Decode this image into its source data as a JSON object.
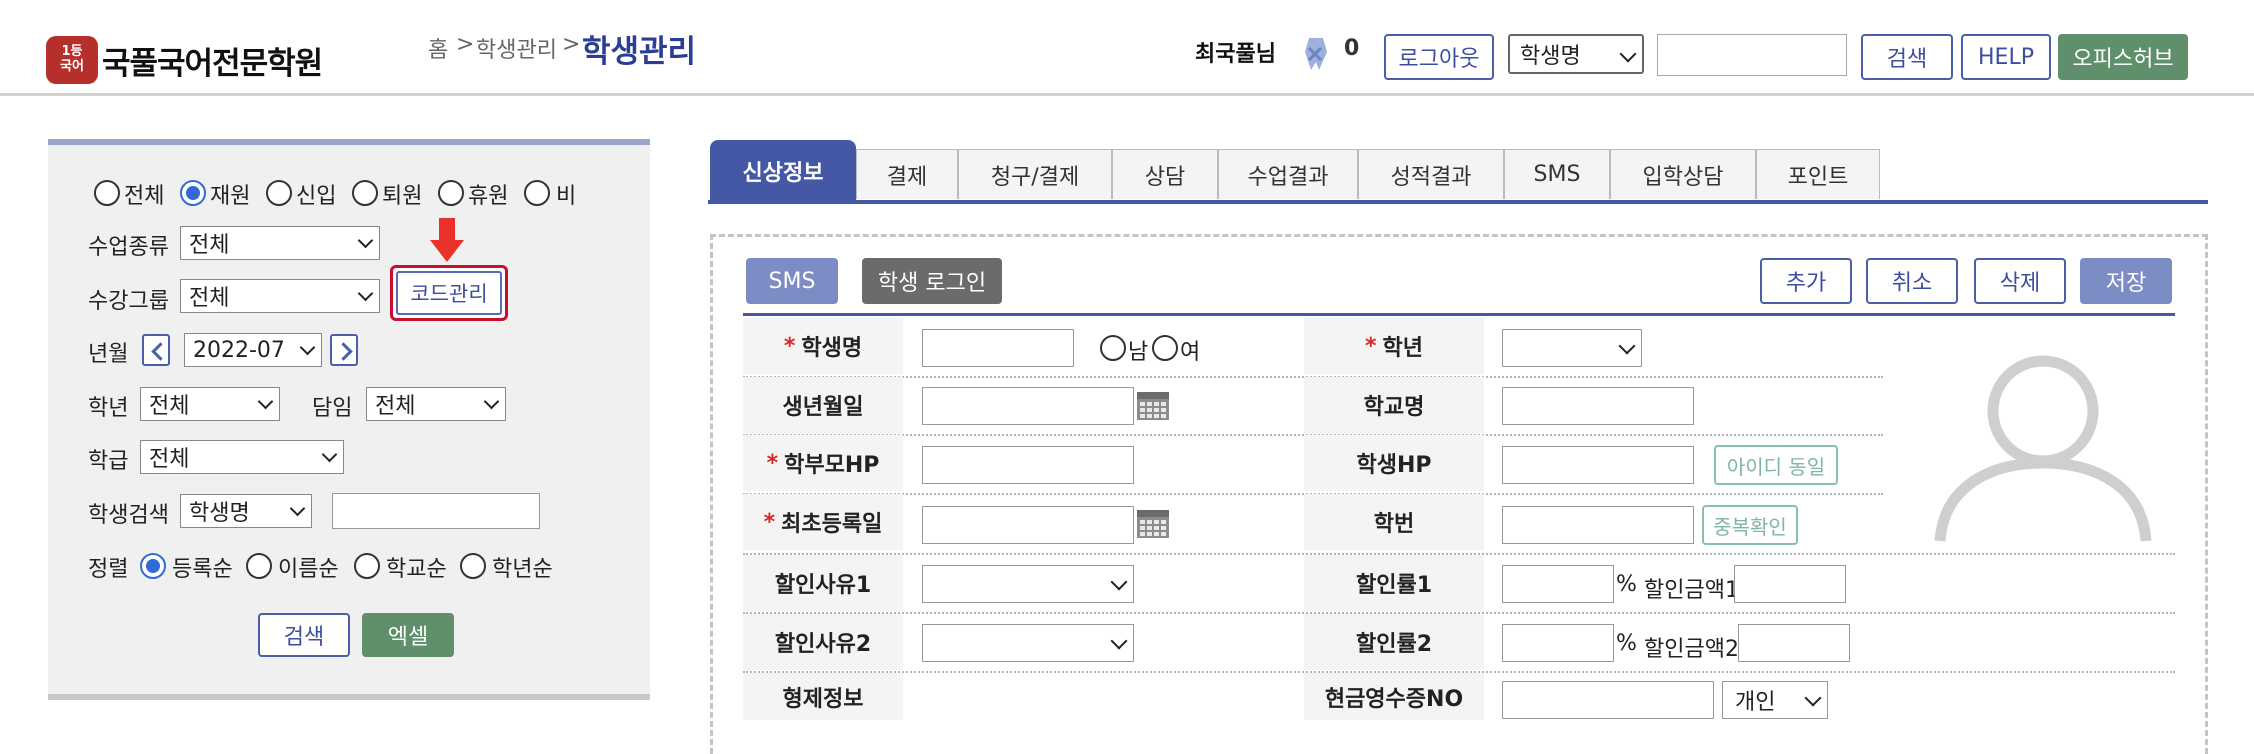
{
  "header": {
    "logo_mark": "1등\n국어",
    "logo_text": "국풀국어전문학원",
    "breadcrumb": [
      "홈",
      ">",
      "학생관리",
      ">"
    ],
    "current_page": "학생관리",
    "user_name": "최국풀님",
    "notification_count": "0",
    "logout_label": "로그아웃",
    "search_type": "학생명",
    "search_label": "검색",
    "help_label": "HELP",
    "officehub_label": "오피스허브"
  },
  "filter": {
    "status_options": [
      "전체",
      "재원",
      "신입",
      "퇴원",
      "휴원",
      "비"
    ],
    "status_selected": "재원",
    "class_type_label": "수업종류",
    "class_type_value": "전체",
    "group_label": "수강그룹",
    "group_value": "전체",
    "code_manage_label": "코드관리",
    "month_label": "년월",
    "month_value": "2022-07",
    "grade_label": "학년",
    "grade_value": "전체",
    "teacher_label": "담임",
    "teacher_value": "전체",
    "class_label": "학급",
    "class_value": "전체",
    "student_search_label": "학생검색",
    "student_search_type": "학생명",
    "sort_label": "정렬",
    "sort_options": [
      "등록순",
      "이름순",
      "학교순",
      "학년순"
    ],
    "sort_selected": "등록순",
    "search_button": "검색",
    "excel_button": "엑셀"
  },
  "tabs": [
    "신상정보",
    "결제",
    "청구/결제",
    "상담",
    "수업결과",
    "성적결과",
    "SMS",
    "입학상담",
    "포인트"
  ],
  "active_tab": "신상정보",
  "actions": {
    "sms": "SMS",
    "student_login": "학생 로그인",
    "add": "추가",
    "cancel": "취소",
    "delete": "삭제",
    "save": "저장"
  },
  "form": {
    "required_mark": "*",
    "student_name": "학생명",
    "gender_male": "남",
    "gender_female": "여",
    "grade": "학년",
    "birth_date": "생년월일",
    "school_name": "학교명",
    "parent_hp": "학부모HP",
    "student_hp": "학생HP",
    "same_id_button": "아이디 동일",
    "first_reg_date": "최초등록일",
    "student_no": "학번",
    "dup_check_button": "중복확인",
    "discount_reason1": "할인사유1",
    "discount_rate1": "할인률1",
    "discount_amount1": "할인금액1",
    "discount_reason2": "할인사유2",
    "discount_rate2": "할인률2",
    "discount_amount2": "할인금액2",
    "percent": "%",
    "sibling_info": "형제정보",
    "cash_receipt_no": "현금영수증NO",
    "receipt_type": "개인"
  },
  "colors": {
    "primary": "#4558a6",
    "green": "#5f8f6b",
    "required": "#d62828",
    "highlight": "#c8102e"
  }
}
